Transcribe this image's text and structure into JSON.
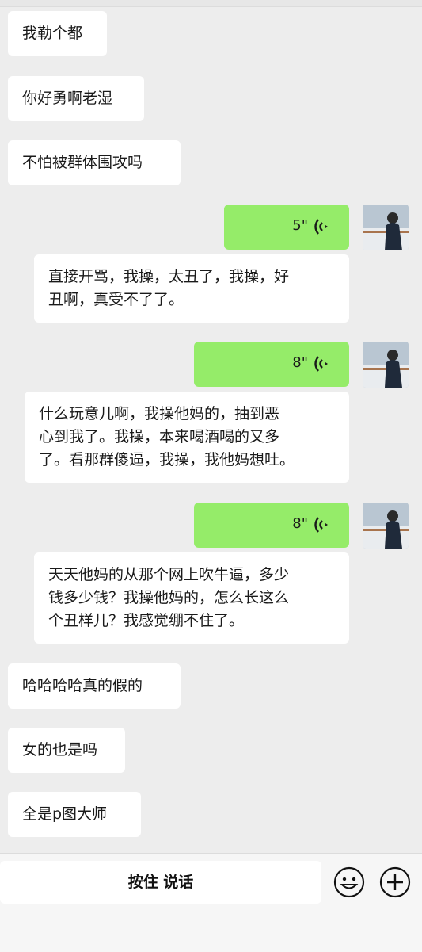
{
  "messages": [
    {
      "side": "left",
      "type": "text",
      "lines": [
        "我勒个都"
      ]
    },
    {
      "side": "left",
      "type": "text",
      "lines": [
        "你好勇啊老湿"
      ]
    },
    {
      "side": "left",
      "type": "text",
      "lines": [
        "不怕被群体围攻吗"
      ]
    },
    {
      "side": "right",
      "type": "voice",
      "duration": "5\""
    },
    {
      "side": "left",
      "type": "text",
      "lines": [
        "直接开骂，我操，太丑了，我操，好",
        "丑啊，真受不了了。"
      ]
    },
    {
      "side": "right",
      "type": "voice",
      "duration": "8\""
    },
    {
      "side": "left",
      "type": "text",
      "lines": [
        "什么玩意儿啊，我操他妈的，抽到恶",
        "心到我了。我操，本来喝酒喝的又多",
        "了。看那群傻逼，我操，我他妈想吐。"
      ]
    },
    {
      "side": "right",
      "type": "voice",
      "duration": "8\""
    },
    {
      "side": "left",
      "type": "text",
      "lines": [
        "天天他妈的从那个网上吹牛逼，多少",
        "钱多少钱？我操他妈的，怎么长这么",
        "个丑样儿？我感觉绷不住了。"
      ]
    },
    {
      "side": "left",
      "type": "text",
      "lines": [
        "哈哈哈哈真的假的"
      ]
    },
    {
      "side": "left",
      "type": "text",
      "lines": [
        "女的也是吗"
      ]
    },
    {
      "side": "left",
      "type": "text",
      "lines": [
        "全是p图大师"
      ]
    }
  ],
  "input": {
    "hold_to_talk_label": "按住 说话"
  },
  "icons": {
    "emoji": "emoji-icon",
    "add": "plus-icon",
    "voice_wave": "voice-wave-icon"
  },
  "colors": {
    "voice_bubble": "#95ec69",
    "text_bubble": "#ffffff",
    "background": "#ededed"
  }
}
